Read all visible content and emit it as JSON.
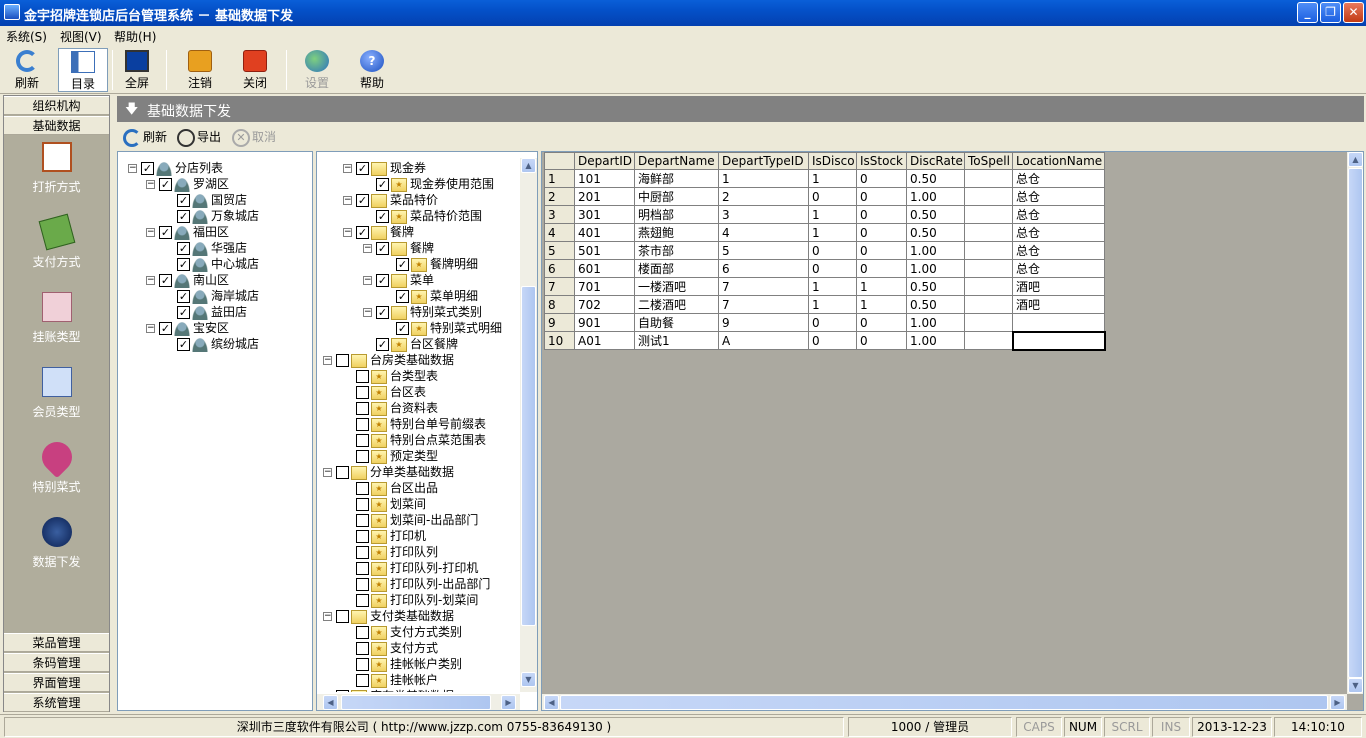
{
  "window": {
    "title": "金宇招牌连锁店后台管理系统  －  基础数据下发"
  },
  "menu": [
    {
      "label": "系统(S)"
    },
    {
      "label": "视图(V)"
    },
    {
      "label": "帮助(H)"
    }
  ],
  "toolbar": [
    {
      "label": "刷新",
      "icon": "refresh-icon"
    },
    {
      "label": "目录",
      "icon": "catalog-icon"
    },
    {
      "label": "全屏",
      "icon": "fullscreen-icon"
    },
    {
      "label": "注销",
      "icon": "logout-icon"
    },
    {
      "label": "关闭",
      "icon": "power-icon"
    },
    {
      "label": "设置",
      "icon": "globe-icon"
    },
    {
      "label": "帮助",
      "icon": "help-icon"
    }
  ],
  "leftnav": {
    "headers_top": [
      "组织机构",
      "基础数据"
    ],
    "items": [
      "打折方式",
      "支付方式",
      "挂账类型",
      "会员类型",
      "特别菜式",
      "数据下发"
    ],
    "headers_bottom": [
      "菜品管理",
      "条码管理",
      "界面管理",
      "系统管理"
    ]
  },
  "content": {
    "title": "基础数据下发"
  },
  "actions": [
    {
      "label": "刷新"
    },
    {
      "label": "导出"
    },
    {
      "label": "取消"
    }
  ],
  "store_tree": [
    {
      "label": "分店列表",
      "level": 0,
      "checked": true,
      "exp": "−"
    },
    {
      "label": "罗湖区",
      "level": 1,
      "checked": true,
      "exp": "−"
    },
    {
      "label": "国贸店",
      "level": 2,
      "checked": true
    },
    {
      "label": "万象城店",
      "level": 2,
      "checked": true
    },
    {
      "label": "福田区",
      "level": 1,
      "checked": true,
      "exp": "−"
    },
    {
      "label": "华强店",
      "level": 2,
      "checked": true
    },
    {
      "label": "中心城店",
      "level": 2,
      "checked": true
    },
    {
      "label": "南山区",
      "level": 1,
      "checked": true,
      "exp": "−"
    },
    {
      "label": "海岸城店",
      "level": 2,
      "checked": true
    },
    {
      "label": "益田店",
      "level": 2,
      "checked": true
    },
    {
      "label": "宝安区",
      "level": 1,
      "checked": true,
      "exp": "−"
    },
    {
      "label": "缤纷城店",
      "level": 2,
      "checked": true
    }
  ],
  "data_tree": [
    {
      "label": "现金券",
      "level": 1,
      "checked": true,
      "exp": "−"
    },
    {
      "label": "现金券使用范围",
      "level": 2,
      "checked": true
    },
    {
      "label": "菜品特价",
      "level": 1,
      "checked": true,
      "exp": "−"
    },
    {
      "label": "菜品特价范围",
      "level": 2,
      "checked": true
    },
    {
      "label": "餐牌",
      "level": 1,
      "checked": true,
      "exp": "−"
    },
    {
      "label": "餐牌",
      "level": 2,
      "checked": true,
      "exp": "−"
    },
    {
      "label": "餐牌明细",
      "level": 3,
      "checked": true
    },
    {
      "label": "菜单",
      "level": 2,
      "checked": true,
      "exp": "−"
    },
    {
      "label": "菜单明细",
      "level": 3,
      "checked": true
    },
    {
      "label": "特别菜式类别",
      "level": 2,
      "checked": true,
      "exp": "−"
    },
    {
      "label": "特别菜式明细",
      "level": 3,
      "checked": true
    },
    {
      "label": "台区餐牌",
      "level": 2,
      "checked": true
    },
    {
      "label": "台房类基础数据",
      "level": 0,
      "checked": false,
      "exp": "−"
    },
    {
      "label": "台类型表",
      "level": 1,
      "checked": false
    },
    {
      "label": "台区表",
      "level": 1,
      "checked": false
    },
    {
      "label": "台资料表",
      "level": 1,
      "checked": false
    },
    {
      "label": "特别台单号前缀表",
      "level": 1,
      "checked": false
    },
    {
      "label": "特别台点菜范围表",
      "level": 1,
      "checked": false
    },
    {
      "label": "预定类型",
      "level": 1,
      "checked": false
    },
    {
      "label": "分单类基础数据",
      "level": 0,
      "checked": false,
      "exp": "−"
    },
    {
      "label": "台区出品",
      "level": 1,
      "checked": false
    },
    {
      "label": "划菜间",
      "level": 1,
      "checked": false
    },
    {
      "label": "划菜间-出品部门",
      "level": 1,
      "checked": false
    },
    {
      "label": "打印机",
      "level": 1,
      "checked": false
    },
    {
      "label": "打印队列",
      "level": 1,
      "checked": false
    },
    {
      "label": "打印队列-打印机",
      "level": 1,
      "checked": false
    },
    {
      "label": "打印队列-出品部门",
      "level": 1,
      "checked": false
    },
    {
      "label": "打印队列-划菜间",
      "level": 1,
      "checked": false
    },
    {
      "label": "支付类基础数据",
      "level": 0,
      "checked": false,
      "exp": "−"
    },
    {
      "label": "支付方式类别",
      "level": 1,
      "checked": false
    },
    {
      "label": "支付方式",
      "level": 1,
      "checked": false
    },
    {
      "label": "挂帐帐户类别",
      "level": 1,
      "checked": false
    },
    {
      "label": "挂帐帐户",
      "level": 1,
      "checked": false
    },
    {
      "label": "库存类基础数据",
      "level": 0,
      "checked": false,
      "exp": "−"
    }
  ],
  "grid": {
    "columns": [
      "DepartID",
      "DepartName",
      "DepartTypeID",
      "IsDisco",
      "IsStock",
      "DiscRate",
      "ToSpell",
      "LocationName"
    ],
    "rows": [
      [
        "1",
        "101",
        "海鲜部",
        "1",
        "1",
        "0",
        "0.50",
        "",
        "总仓"
      ],
      [
        "2",
        "201",
        "中厨部",
        "2",
        "0",
        "0",
        "1.00",
        "",
        "总仓"
      ],
      [
        "3",
        "301",
        "明档部",
        "3",
        "1",
        "0",
        "0.50",
        "",
        "总仓"
      ],
      [
        "4",
        "401",
        "燕翅鲍",
        "4",
        "1",
        "0",
        "0.50",
        "",
        "总仓"
      ],
      [
        "5",
        "501",
        "茶市部",
        "5",
        "0",
        "0",
        "1.00",
        "",
        "总仓"
      ],
      [
        "6",
        "601",
        "楼面部",
        "6",
        "0",
        "0",
        "1.00",
        "",
        "总仓"
      ],
      [
        "7",
        "701",
        "一楼酒吧",
        "7",
        "1",
        "1",
        "0.50",
        "",
        "酒吧"
      ],
      [
        "8",
        "702",
        "二楼酒吧",
        "7",
        "1",
        "1",
        "0.50",
        "",
        "酒吧"
      ],
      [
        "9",
        "901",
        "自助餐",
        "9",
        "0",
        "0",
        "1.00",
        "",
        ""
      ],
      [
        "10",
        "A01",
        "测试1",
        "A",
        "0",
        "0",
        "1.00",
        "",
        ""
      ]
    ]
  },
  "status": {
    "company": "深圳市三度软件有限公司 ( http://www.jzzp.com  0755-83649130 )",
    "user": "1000 / 管理员",
    "caps": "CAPS",
    "num": "NUM",
    "scrl": "SCRL",
    "ins": "INS",
    "date": "2013-12-23",
    "time": "14:10:10"
  },
  "colors": {
    "titlebar": "#0450c8",
    "panel": "#ece9d8",
    "nav_bg": "#b0ad9c",
    "header_bar": "#818181"
  }
}
